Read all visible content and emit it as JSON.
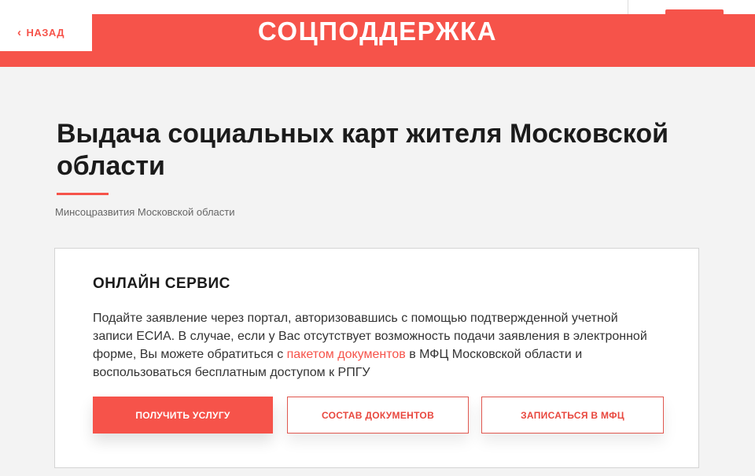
{
  "header": {
    "back_label": "НАЗАД",
    "brand": "СОЦПОДДЕРЖКА"
  },
  "page": {
    "title": "Выдача социальных карт жителя Московской области",
    "ministry": "Минсоцразвития Московской области"
  },
  "service": {
    "heading": "ОНЛАЙН СЕРВИС",
    "text_before_link": "Подайте заявление через портал, авторизовавшись с помощью подтвержденной учетной записи ЕСИА. В случае, если у Вас отсутствует возможность подачи заявления в электронной форме, Вы можете обратиться с ",
    "link_text": "пакетом документов",
    "text_after_link": " в МФЦ Московской области и воспользоваться бесплатным доступом к РПГУ",
    "buttons": {
      "get_service": "ПОЛУЧИТЬ УСЛУГУ",
      "documents": "СОСТАВ ДОКУМЕНТОВ",
      "mfc": "ЗАПИСАТЬСЯ В МФЦ"
    }
  },
  "colors": {
    "accent": "#f6534a",
    "background": "#f3f3f3"
  },
  "icons": {
    "back": "chevron-left-icon"
  }
}
